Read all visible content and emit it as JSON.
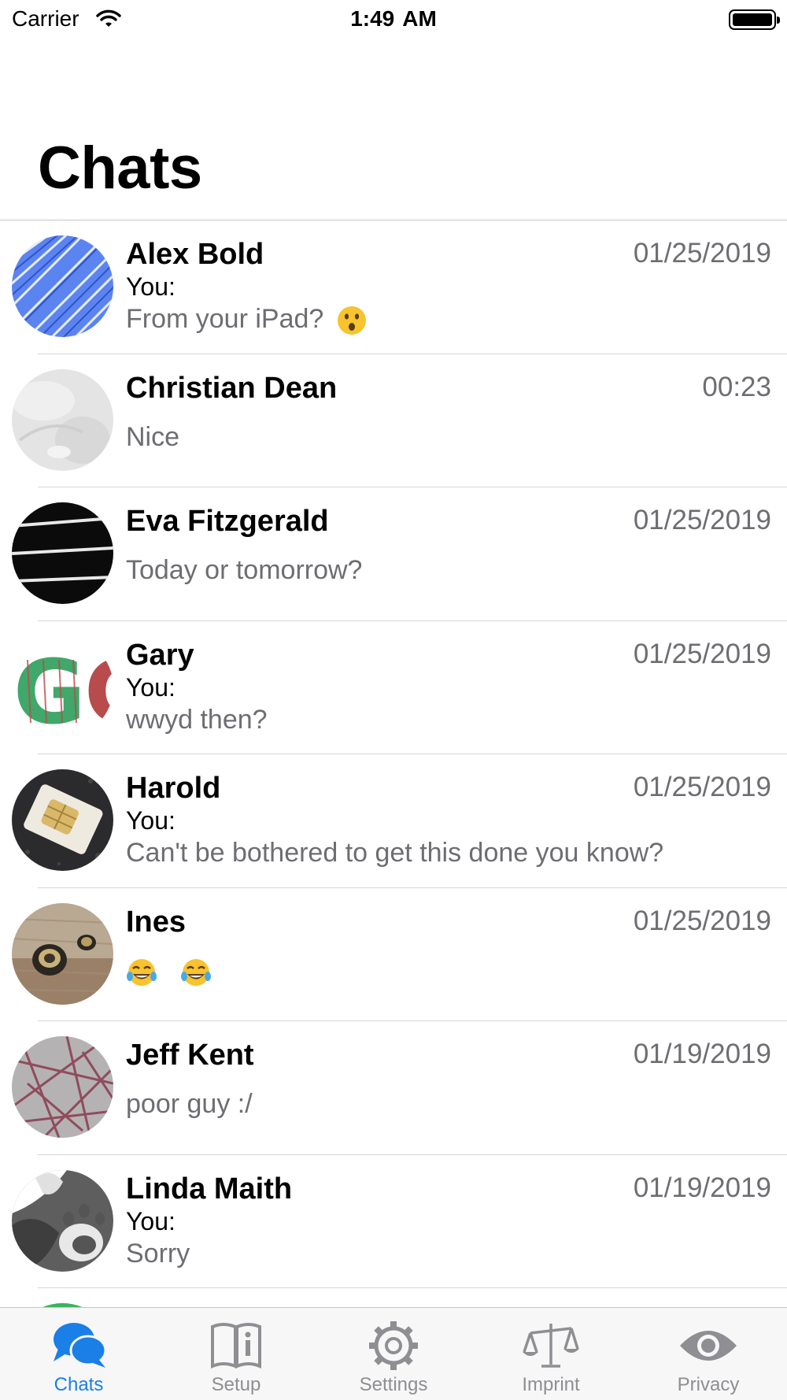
{
  "status_bar": {
    "carrier": "Carrier",
    "time": "1:49",
    "ampm": "AM"
  },
  "header": {
    "title": "Chats"
  },
  "chats": [
    {
      "name": "Alex Bold",
      "date": "01/25/2019",
      "you_label": "You:",
      "message": "From your iPad?",
      "emoji": "astonished-face"
    },
    {
      "name": "Christian Dean",
      "date": "00:23",
      "you_label": "",
      "message": "Nice"
    },
    {
      "name": "Eva Fitzgerald",
      "date": "01/25/2019",
      "you_label": "",
      "message": "Today or tomorrow?"
    },
    {
      "name": "Gary",
      "date": "01/25/2019",
      "you_label": "You:",
      "message": "wwyd then?"
    },
    {
      "name": "Harold",
      "date": "01/25/2019",
      "you_label": "You:",
      "message": "Can't be bothered to get this done you know?"
    },
    {
      "name": "Ines",
      "date": "01/25/2019",
      "you_label": "",
      "message": "",
      "emoji": "tears-of-joy-x2"
    },
    {
      "name": "Jeff Kent",
      "date": "01/19/2019",
      "you_label": "",
      "message": "poor guy :/"
    },
    {
      "name": "Linda Maith",
      "date": "01/19/2019",
      "you_label": "You:",
      "message": "Sorry"
    }
  ],
  "tabs": [
    {
      "label": "Chats",
      "icon": "chat-bubbles-icon",
      "active": true
    },
    {
      "label": "Setup",
      "icon": "book-info-icon",
      "active": false
    },
    {
      "label": "Settings",
      "icon": "gear-icon",
      "active": false
    },
    {
      "label": "Imprint",
      "icon": "scales-icon",
      "active": false
    },
    {
      "label": "Privacy",
      "icon": "eye-icon",
      "active": false
    }
  ],
  "colors": {
    "accent": "#1a7fe6",
    "secondary_text": "#6d6d72",
    "tab_inactive": "#8e8e93"
  }
}
